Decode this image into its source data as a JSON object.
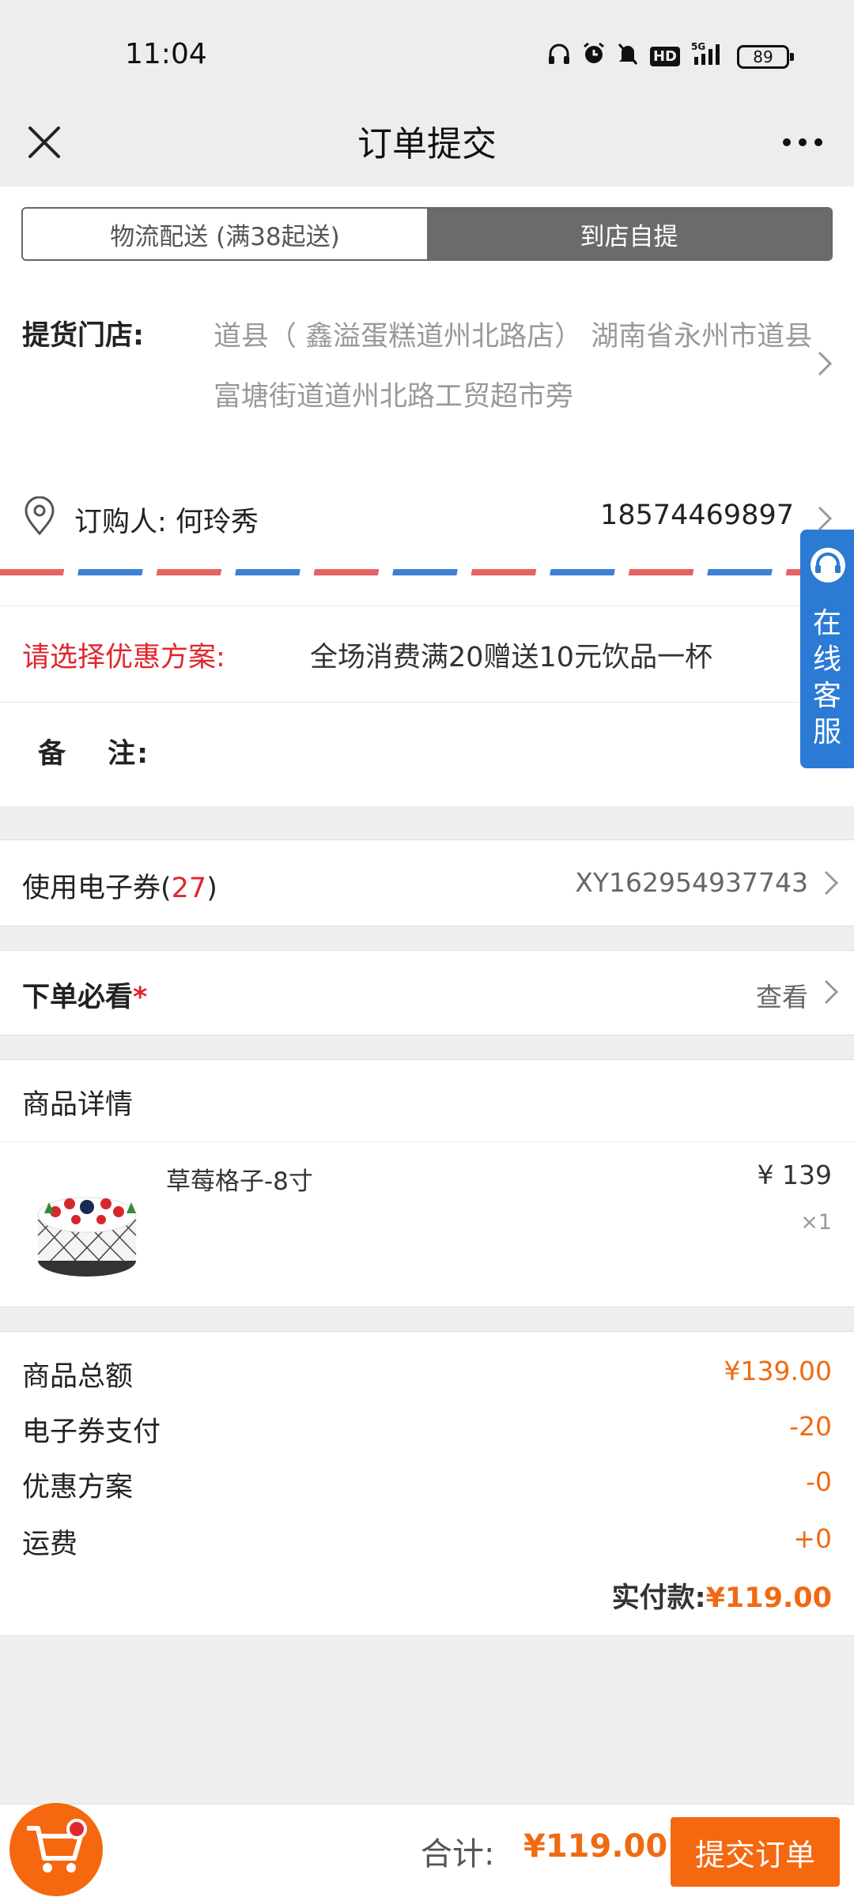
{
  "status_bar": {
    "time": "11:04",
    "network": "5G",
    "hd": "HD",
    "battery": "89"
  },
  "header": {
    "title": "订单提交"
  },
  "delivery": {
    "tabs": [
      {
        "label": "物流配送 (满38起送)",
        "active": false
      },
      {
        "label": "到店自提",
        "active": true
      }
    ]
  },
  "store": {
    "label": "提货门店:",
    "address": "道县（ 鑫溢蛋糕道州北路店） 湖南省永州市道县富塘街道道州北路工贸超市旁"
  },
  "buyer": {
    "label": "订购人:",
    "name": "何玲秀",
    "phone": "18574469897"
  },
  "promo": {
    "label": "请选择优惠方案:",
    "value": "全场消费满20赠送10元饮品一杯"
  },
  "remark": {
    "label": "备　 注:"
  },
  "service": {
    "text": "在线客服"
  },
  "coupon": {
    "label": "使用电子券(",
    "count": "27",
    "label_end": ")",
    "value": "XY162954937743"
  },
  "notice": {
    "label": "下单必看",
    "required_mark": "*",
    "action": "查看"
  },
  "goods": {
    "header": "商品详情",
    "items": [
      {
        "name": "草莓格子-8寸",
        "price": "¥ 139",
        "qty": "×1"
      }
    ]
  },
  "summary": {
    "rows": [
      {
        "label": "商品总额",
        "value": "¥139.00"
      },
      {
        "label": "电子券支付",
        "value": "-20"
      },
      {
        "label": "优惠方案",
        "value": "-0"
      },
      {
        "label": "运费",
        "value": "+0"
      }
    ],
    "actual_label": "实付款:",
    "actual_value": "¥119.00"
  },
  "bottom_bar": {
    "total_label": "合计:",
    "total_amount": "¥119.00",
    "submit_label": "提交订单"
  },
  "colors": {
    "accent": "#f5680f",
    "price": "#f06a12",
    "alert": "#e0262d",
    "service": "#2b7bd4"
  },
  "icons": [
    "close-icon",
    "more-icon",
    "location-icon",
    "chevron-right-icon",
    "headset-icon",
    "cart-icon"
  ]
}
